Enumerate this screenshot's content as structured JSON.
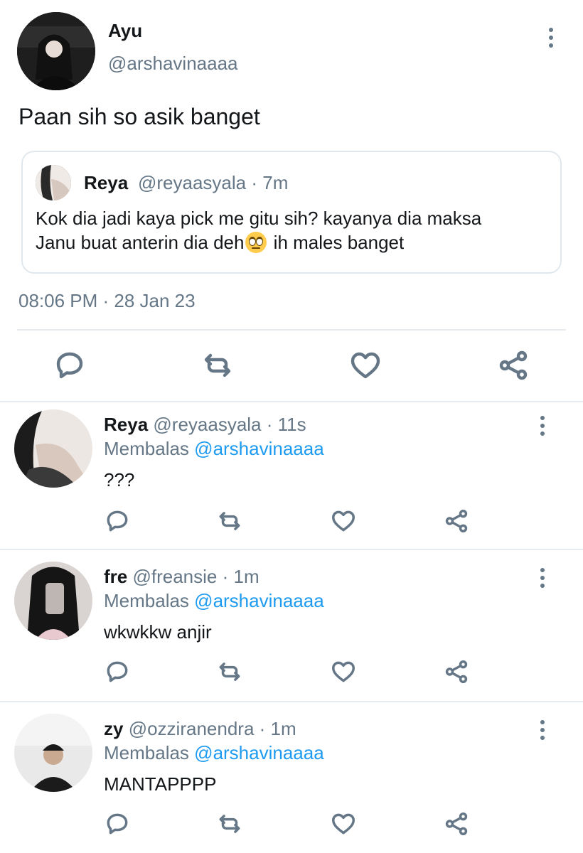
{
  "main_tweet": {
    "name": "Ayu",
    "handle": "@arshavinaaaa",
    "text": "Paan sih so asik banget",
    "quote": {
      "name": "Reya",
      "handle_time": "@reyaasyala · 7m",
      "text_line1": "Kok dia jadi kaya pick me gitu sih? kayanya dia maksa",
      "text_line2_before": "Janu buat anterin dia deh",
      "emoji": "face-with-rolling-eyes",
      "text_line2_after": " ih males banget"
    },
    "timestamp": "08:06 PM · 28 Jan 23"
  },
  "icons": {
    "reply": "speech-bubble-icon",
    "retweet": "retweet-icon",
    "like": "heart-icon",
    "share": "share-icon",
    "more": "more-vertical-icon"
  },
  "replies": [
    {
      "name": "Reya",
      "meta": "@reyaasyala · 11s",
      "replying_prefix": "Membalas",
      "replying_to": "@arshavinaaaa",
      "text": "???"
    },
    {
      "name": "fre",
      "meta": "@freansie · 1m",
      "replying_prefix": "Membalas",
      "replying_to": "@arshavinaaaa",
      "text": "wkwkkw anjir"
    },
    {
      "name": "zy",
      "meta": "@ozziranendra · 1m",
      "replying_prefix": "Membalas",
      "replying_to": "@arshavinaaaa",
      "text": "MANTAPPPP"
    }
  ],
  "colors": {
    "link": "#1d9bf0",
    "secondary_text": "#657786",
    "divider": "#e6ecf0"
  }
}
